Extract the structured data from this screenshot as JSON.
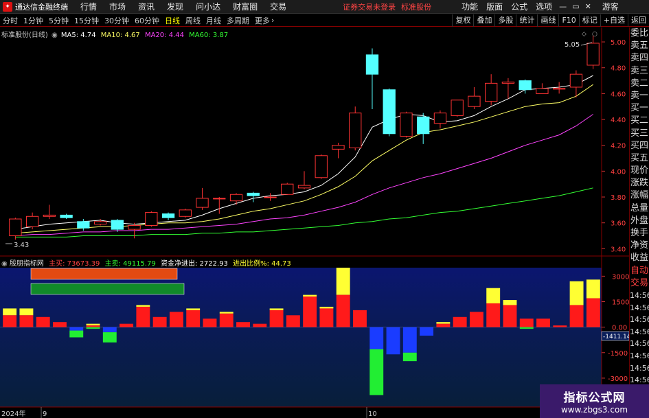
{
  "app": {
    "title": "通达信金融终端",
    "menus": [
      "行情",
      "市场",
      "资讯",
      "发现",
      "问小达",
      "财富圈",
      "交易"
    ],
    "login_warning": "证券交易未登录",
    "stock_label": "标准股份",
    "right_menus": [
      "功能",
      "版面",
      "公式",
      "选项"
    ],
    "guest": "游客",
    "window_controls": [
      "—",
      "▭",
      "✕"
    ]
  },
  "toolbar": {
    "periods": [
      "分时",
      "1分钟",
      "5分钟",
      "15分钟",
      "30分钟",
      "60分钟",
      "日线",
      "周线",
      "月线",
      "多周期",
      "更多"
    ],
    "active_period": "日线",
    "right_buttons": [
      "复权",
      "叠加",
      "多股",
      "统计",
      "画线",
      "F10",
      "标记",
      "+自选",
      "返回"
    ]
  },
  "main_chart": {
    "name": "标准股份(日线)",
    "ma": [
      {
        "label": "MA5: 4.74",
        "color": "#ffffff"
      },
      {
        "label": "MA10: 4.67",
        "color": "#ffff66"
      },
      {
        "label": "MA20: 4.44",
        "color": "#ff44ff"
      },
      {
        "label": "MA60: 3.87",
        "color": "#33ff33"
      }
    ],
    "high_label": "5.05",
    "low_label": "3.43"
  },
  "sub_chart": {
    "name": "殷朋指标网",
    "main_buy": "主买: 73673.39",
    "main_sell": "主卖: 49115.79",
    "net_flow": "资金净进出: 2722.93",
    "ratio": "进出比例%: 44.73",
    "cursor_value": "-1411.14"
  },
  "axis": {
    "price_ticks": [
      "5.00",
      "4.80",
      "4.60",
      "4.40",
      "4.20",
      "4.00",
      "3.80",
      "3.60",
      "3.40"
    ],
    "sub_ticks": [
      "3000",
      "1500",
      "0.00",
      "-1500",
      "-3000"
    ],
    "date_labels": [
      "2024年",
      "9",
      "10"
    ]
  },
  "right_column": [
    "委比",
    "卖五",
    "卖四",
    "卖三",
    "卖二",
    "卖一",
    "买一",
    "买二",
    "买三",
    "买四",
    "买五",
    "现价",
    "涨跌",
    "涨幅",
    "总量",
    "外盘",
    "换手",
    "净资",
    "收益",
    "自动",
    "交易",
    "14:56",
    "14:56",
    "14:56",
    "14:56",
    "14:56",
    "14:56",
    "14:56",
    "14:56",
    "14:56"
  ],
  "watermark": {
    "line1": "指标公式网",
    "line2": "www.zbgs3.com"
  },
  "chart_data": [
    {
      "type": "candlestick",
      "title": "标准股份(日线)",
      "ylim": [
        3.4,
        5.05
      ],
      "candles": [
        {
          "o": 3.5,
          "c": 3.63,
          "h": 3.64,
          "l": 3.47
        },
        {
          "o": 3.57,
          "c": 3.65,
          "h": 3.68,
          "l": 3.55
        },
        {
          "o": 3.65,
          "c": 3.66,
          "h": 3.74,
          "l": 3.63
        },
        {
          "o": 3.66,
          "c": 3.64,
          "h": 3.67,
          "l": 3.63
        },
        {
          "o": 3.61,
          "c": 3.56,
          "h": 3.63,
          "l": 3.54
        },
        {
          "o": 3.59,
          "c": 3.61,
          "h": 3.63,
          "l": 3.58
        },
        {
          "o": 3.62,
          "c": 3.55,
          "h": 3.63,
          "l": 3.53
        },
        {
          "o": 3.55,
          "c": 3.58,
          "h": 3.6,
          "l": 3.48
        },
        {
          "o": 3.58,
          "c": 3.68,
          "h": 3.69,
          "l": 3.57
        },
        {
          "o": 3.67,
          "c": 3.64,
          "h": 3.68,
          "l": 3.62
        },
        {
          "o": 3.65,
          "c": 3.7,
          "h": 3.71,
          "l": 3.64
        },
        {
          "o": 3.72,
          "c": 3.79,
          "h": 3.87,
          "l": 3.7
        },
        {
          "o": 3.79,
          "c": 3.79,
          "h": 3.8,
          "l": 3.67
        },
        {
          "o": 3.77,
          "c": 3.82,
          "h": 3.83,
          "l": 3.74
        },
        {
          "o": 3.83,
          "c": 3.81,
          "h": 3.84,
          "l": 3.76
        },
        {
          "o": 3.8,
          "c": 3.8,
          "h": 3.83,
          "l": 3.77
        },
        {
          "o": 3.82,
          "c": 3.9,
          "h": 3.91,
          "l": 3.82
        },
        {
          "o": 3.87,
          "c": 3.89,
          "h": 4.0,
          "l": 3.86
        },
        {
          "o": 3.95,
          "c": 4.12,
          "h": 4.13,
          "l": 3.94
        },
        {
          "o": 4.17,
          "c": 4.2,
          "h": 4.22,
          "l": 4.1
        },
        {
          "o": 4.18,
          "c": 4.45,
          "h": 4.5,
          "l": 4.16
        },
        {
          "o": 4.9,
          "c": 4.75,
          "h": 4.95,
          "l": 4.48
        },
        {
          "o": 4.63,
          "c": 4.29,
          "h": 4.64,
          "l": 4.27
        },
        {
          "o": 4.27,
          "c": 4.45,
          "h": 4.46,
          "l": 4.26
        },
        {
          "o": 4.42,
          "c": 4.29,
          "h": 4.45,
          "l": 4.21
        },
        {
          "o": 4.37,
          "c": 4.45,
          "h": 4.47,
          "l": 4.33
        },
        {
          "o": 4.43,
          "c": 4.55,
          "h": 4.55,
          "l": 4.42
        },
        {
          "o": 4.5,
          "c": 4.58,
          "h": 4.65,
          "l": 4.48
        },
        {
          "o": 4.54,
          "c": 4.68,
          "h": 4.75,
          "l": 4.51
        },
        {
          "o": 4.68,
          "c": 4.69,
          "h": 4.72,
          "l": 4.56
        },
        {
          "o": 4.7,
          "c": 4.63,
          "h": 4.71,
          "l": 4.6
        },
        {
          "o": 4.6,
          "c": 4.64,
          "h": 4.68,
          "l": 4.6
        },
        {
          "o": 4.64,
          "c": 4.64,
          "h": 4.69,
          "l": 4.6
        },
        {
          "o": 4.65,
          "c": 4.75,
          "h": 4.78,
          "l": 4.57
        },
        {
          "o": 4.82,
          "c": 4.99,
          "h": 5.05,
          "l": 4.79
        }
      ],
      "ma5": [
        3.55,
        3.57,
        3.59,
        3.6,
        3.61,
        3.62,
        3.6,
        3.59,
        3.6,
        3.61,
        3.62,
        3.66,
        3.71,
        3.75,
        3.79,
        3.81,
        3.82,
        3.84,
        3.89,
        3.98,
        4.11,
        4.34,
        4.4,
        4.44,
        4.43,
        4.38,
        4.39,
        4.43,
        4.5,
        4.56,
        4.63,
        4.64,
        4.65,
        4.67,
        4.74
      ],
      "ma10": [
        3.52,
        3.53,
        3.54,
        3.55,
        3.56,
        3.57,
        3.57,
        3.58,
        3.59,
        3.6,
        3.6,
        3.61,
        3.63,
        3.66,
        3.69,
        3.71,
        3.74,
        3.77,
        3.82,
        3.88,
        3.96,
        4.08,
        4.16,
        4.24,
        4.3,
        4.32,
        4.35,
        4.38,
        4.42,
        4.46,
        4.5,
        4.52,
        4.53,
        4.58,
        4.67
      ],
      "ma20": [
        3.5,
        3.51,
        3.51,
        3.52,
        3.53,
        3.53,
        3.54,
        3.54,
        3.55,
        3.55,
        3.56,
        3.57,
        3.58,
        3.59,
        3.61,
        3.63,
        3.64,
        3.66,
        3.69,
        3.72,
        3.76,
        3.82,
        3.87,
        3.91,
        3.95,
        3.98,
        4.02,
        4.06,
        4.1,
        4.15,
        4.2,
        4.24,
        4.28,
        4.35,
        4.44
      ],
      "ma60": [
        3.49,
        3.49,
        3.49,
        3.49,
        3.5,
        3.5,
        3.5,
        3.5,
        3.51,
        3.51,
        3.51,
        3.52,
        3.52,
        3.53,
        3.53,
        3.54,
        3.55,
        3.56,
        3.57,
        3.58,
        3.6,
        3.61,
        3.63,
        3.64,
        3.66,
        3.68,
        3.69,
        3.71,
        3.73,
        3.75,
        3.77,
        3.79,
        3.81,
        3.84,
        3.87
      ]
    },
    {
      "type": "bar",
      "title": "殷朋指标网",
      "ylim": [
        -4700,
        3500
      ],
      "net": [
        700,
        700,
        600,
        300,
        -200,
        100,
        -300,
        200,
        1200,
        600,
        900,
        1000,
        500,
        800,
        300,
        200,
        1000,
        700,
        1800,
        1100,
        1900,
        1000,
        -1300,
        -1600,
        -1500,
        -500,
        200,
        600,
        900,
        1400,
        1300,
        500,
        500,
        100,
        1300,
        1700
      ],
      "top": [
        1100,
        1100,
        600,
        300,
        -200,
        200,
        -300,
        200,
        1300,
        600,
        900,
        1100,
        500,
        900,
        300,
        200,
        1100,
        700,
        1900,
        1200,
        3500,
        1000,
        -1300,
        -1600,
        -1500,
        -500,
        300,
        600,
        900,
        2300,
        1600,
        500,
        500,
        100,
        2700,
        2800
      ],
      "low": [
        0,
        0,
        0,
        0,
        -600,
        -100,
        -900,
        0,
        0,
        0,
        0,
        0,
        0,
        0,
        0,
        0,
        0,
        0,
        0,
        0,
        0,
        0,
        -4000,
        -1600,
        -2000,
        0,
        0,
        0,
        0,
        0,
        0,
        -100,
        0,
        0,
        0,
        0
      ]
    }
  ]
}
